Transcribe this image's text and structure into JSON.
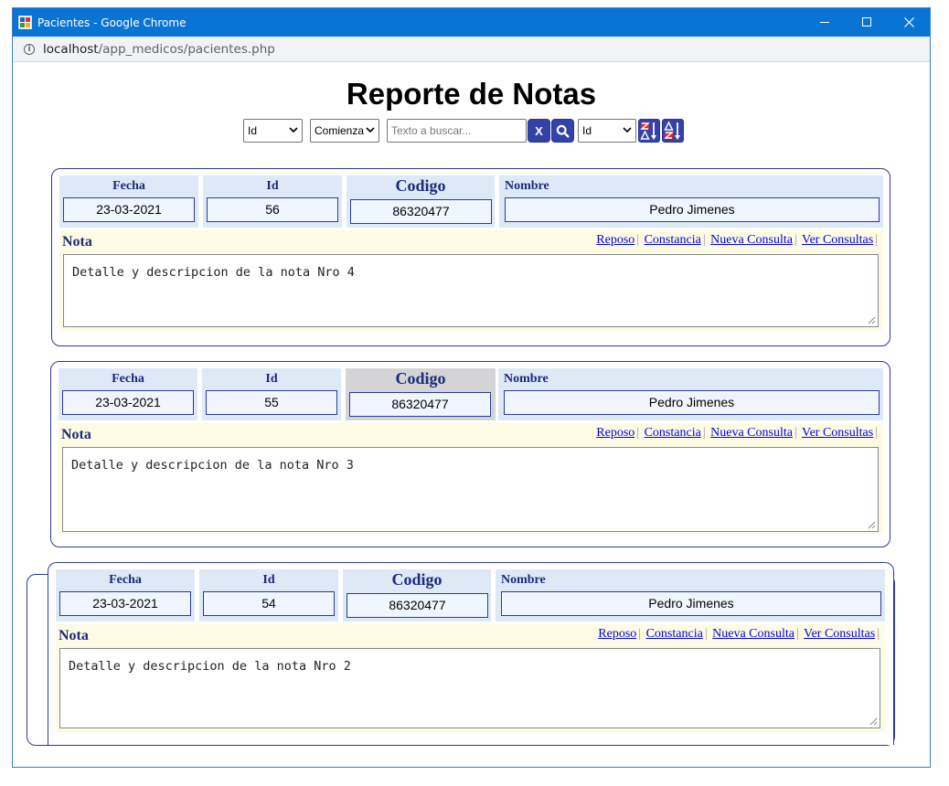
{
  "window": {
    "title": "Pacientes - Google Chrome",
    "url_host": "localhost",
    "url_path": "/app_medicos/pacientes.php",
    "minimize": "—",
    "maximize": "☐",
    "close": "✕"
  },
  "page": {
    "title": "Reporte de Notas"
  },
  "toolbar": {
    "field_select": "Id",
    "mode_select": "Comienza",
    "search_placeholder": "Texto a buscar...",
    "clear_label": "X",
    "order_select": "Id"
  },
  "labels": {
    "fecha": "Fecha",
    "id": "Id",
    "codigo": "Codigo",
    "nombre": "Nombre",
    "nota": "Nota",
    "reposo": "Reposo",
    "constancia": "Constancia",
    "nueva_consulta": "Nueva Consulta",
    "ver_consultas": "Ver Consultas",
    "sep": "|"
  },
  "notes": [
    {
      "fecha": "23-03-2021",
      "id": "56",
      "codigo": "86320477",
      "nombre": "Pedro Jimenes",
      "nota": "Detalle y descripcion de la nota Nro 4"
    },
    {
      "fecha": "23-03-2021",
      "id": "55",
      "codigo": "86320477",
      "nombre": "Pedro Jimenes",
      "nota": "Detalle y descripcion de la nota Nro 3"
    },
    {
      "fecha": "23-03-2021",
      "id": "54",
      "codigo": "86320477",
      "nombre": "Pedro Jimenes",
      "nota": "Detalle y descripcion de la nota Nro 2"
    }
  ],
  "colors": {
    "titlebar": "#0a74d4",
    "accent": "#3342a7",
    "card_border": "#2c3a9a",
    "field_bg": "#dde9f6",
    "note_bg": "#fdfbe3"
  }
}
